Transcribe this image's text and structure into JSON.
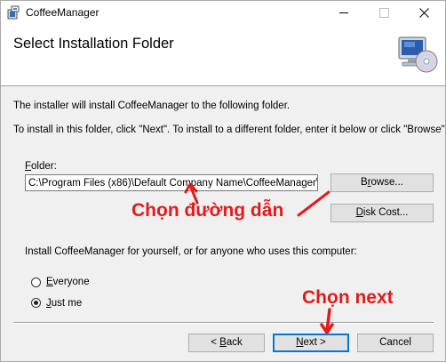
{
  "window": {
    "title": "CoffeeManager",
    "icon": "installer-icon",
    "controls": [
      "minimize-icon",
      "maximize-icon",
      "close-icon"
    ]
  },
  "header": {
    "title": "Select Installation Folder",
    "graphic": "computer-cd-icon"
  },
  "body": {
    "line1": "The installer will install CoffeeManager to the following folder.",
    "line2": "To install in this folder, click \"Next\". To install to a different folder, enter it below or click \"Browse\"."
  },
  "folder": {
    "label_mnemonic": "F",
    "label_rest": "older:",
    "value": "C:\\Program Files (x86)\\Default Company Name\\CoffeeManager\\"
  },
  "buttons": {
    "browse_mnemonic": "r",
    "browse_pre": "B",
    "browse_post": "owse...",
    "disk_cost_mnemonic": "D",
    "disk_cost_rest": "isk Cost...",
    "back_mnemonic": "B",
    "back_pre": "< ",
    "back_post": "ack",
    "next_mnemonic": "N",
    "next_post": "ext >",
    "cancel": "Cancel"
  },
  "install_for": {
    "question": "Install CoffeeManager for yourself, or for anyone who uses this computer:",
    "options": [
      {
        "mnemonic": "E",
        "rest": "veryone",
        "selected": false
      },
      {
        "mnemonic": "J",
        "rest": "ust me",
        "selected": true
      }
    ]
  },
  "annotations": {
    "choose_path": "Chọn đường dẫn",
    "choose_next": "Chọn next",
    "color": "#e21b1b"
  },
  "colors": {
    "dialog_bg": "#f0f0f0",
    "header_bg": "#ffffff",
    "button_bg": "#e1e1e1",
    "default_button_border": "#0078d7",
    "annotation": "#e21b1b"
  }
}
